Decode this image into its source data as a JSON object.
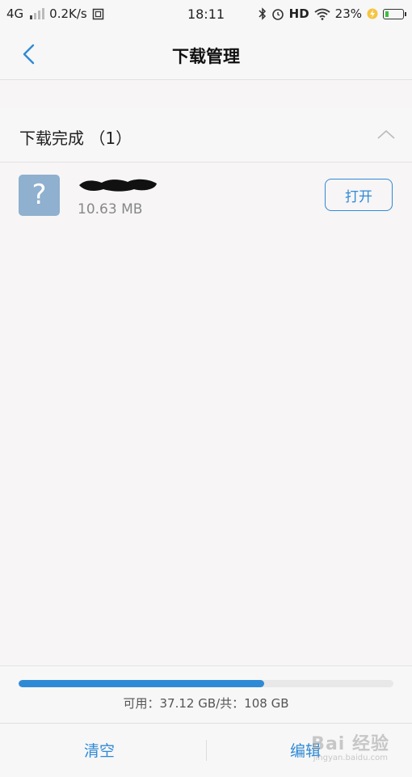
{
  "status_bar": {
    "network": "4G",
    "speed": "0.2K/s",
    "time": "18:11",
    "hd": "HD",
    "battery_percent": "23%",
    "battery_level": 0.23
  },
  "nav": {
    "title": "下载管理"
  },
  "section": {
    "title": "下载完成 （1）"
  },
  "download_item": {
    "icon_glyph": "?",
    "size": "10.63 MB",
    "open_label": "打开"
  },
  "storage": {
    "available_text": "可用：37.12 GB/共：108 GB",
    "used_fraction": 0.656,
    "bar_color": "#2f8ad6"
  },
  "bottom": {
    "clear_label": "清空",
    "edit_label": "编辑"
  },
  "watermark": {
    "text": "Bai 经验",
    "sub": "jingyan.baidu.com"
  },
  "colors": {
    "accent": "#2f8ad6",
    "file_icon_bg": "#8fb0cf",
    "battery_fill": "#3cbf3c"
  }
}
